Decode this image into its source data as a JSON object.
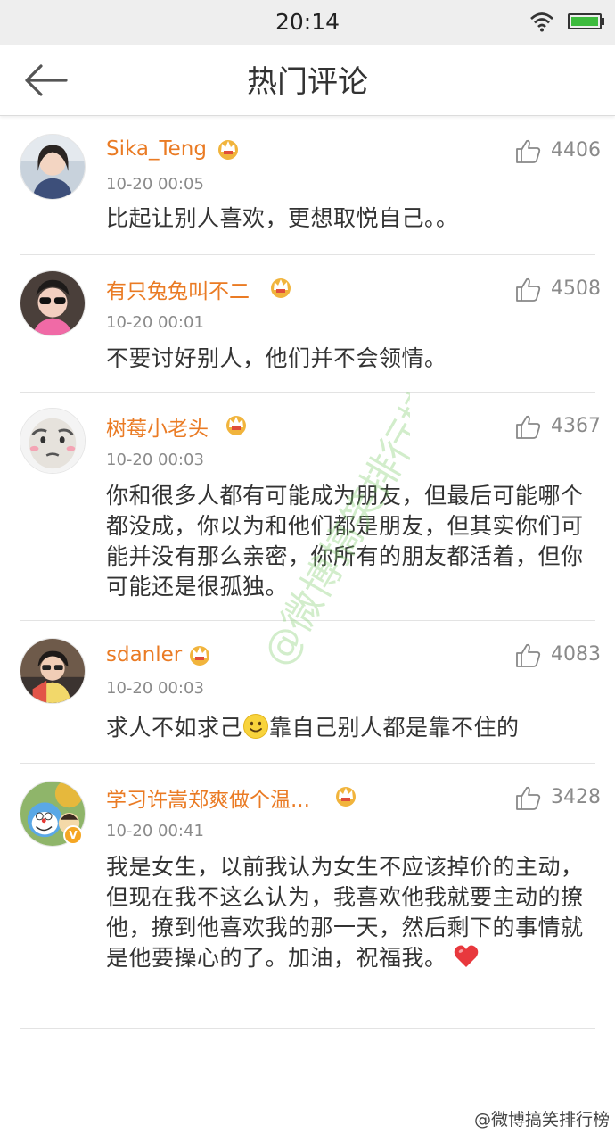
{
  "status_bar": {
    "time": "20:14"
  },
  "header": {
    "title": "热门评论"
  },
  "comments": [
    {
      "username": "Sika_Teng",
      "timestamp": "10-20 00:05",
      "likes": "4406",
      "text": "比起让别人喜欢，更想取悦自己。。"
    },
    {
      "username": "有只兔兔叫不二",
      "timestamp": "10-20 00:01",
      "likes": "4508",
      "text": "不要讨好别人，他们并不会领情。"
    },
    {
      "username": "树莓小老头",
      "timestamp": "10-20 00:03",
      "likes": "4367",
      "text": "你和很多人都有可能成为朋友，但最后可能哪个都没成，你以为和他们都是朋友，但其实你们可能并没有那么亲密，你所有的朋友都活着，但你可能还是很孤独。"
    },
    {
      "username": "sdanler",
      "timestamp": "10-20 00:03",
      "likes": "4083",
      "text_before_emoji": "求人不如求己",
      "text_after_emoji": "靠自己别人都是靠不住的"
    },
    {
      "username": "学习许嵩郑爽做个温...",
      "timestamp": "10-20 00:41",
      "likes": "3428",
      "text": "我是女生，以前我认为女生不应该掉价的主动，但现在我不这么认为，我喜欢他我就要主动的撩他，撩到他喜欢我的那一天，然后剩下的事情就是他要操心的了。加油，祝福我。",
      "verified_badge": "V"
    }
  ],
  "watermark": {
    "text": "@微博搞笑排行榜",
    "footer": "@微博搞笑排行榜"
  },
  "colors": {
    "username": "#ea7b24",
    "meta": "#8a8a8a",
    "crown": "#f1b43c",
    "heart": "#e8383d"
  }
}
